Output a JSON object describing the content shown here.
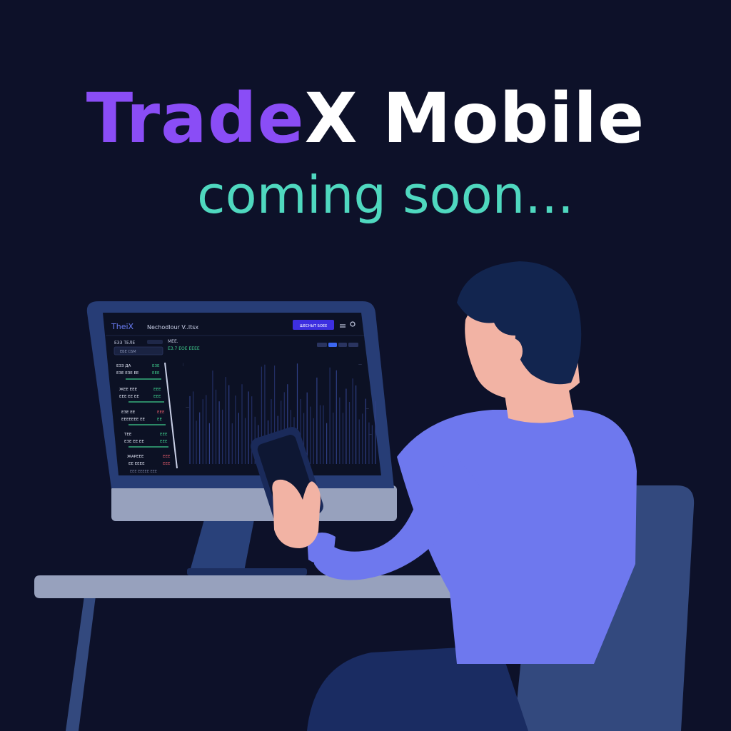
{
  "headline": {
    "brand_part_one": "Trade",
    "brand_part_two": "X Mobile"
  },
  "subline": "coming soon...",
  "screen": {
    "logo": "TheiX",
    "page_title": "Nechodlour V..ltsx",
    "cta_label": "ШЕСНЫТ БОЕЕ",
    "sidebar_title": "ЕЗЗ ТЕЛЕ",
    "sidebar_search": "ЕБЕ СБМ",
    "chart_heading": "МЕЕ.",
    "chart_subheading": "ЕЗ.7 ЕОЕ ЕЕЕЕ",
    "watchlist": [
      {
        "name": "ЕЗЗ ДА",
        "sub": "ЕЗЕ ЕЗЕ ЕЕ",
        "value": "ЕЗЕ",
        "change": "ЕЕЕ"
      },
      {
        "name": "ЖЕЕ ЕЕЕ",
        "sub": "ЕЕЕ ЕЕ ЕЕ",
        "value": "ЕЕЕ",
        "change": "ЕЕЕ"
      },
      {
        "name": "ЕЗЕ ЕЕ",
        "sub": "ЕЕЕЕЕЕЕ ЕЕ",
        "value": "ЕЕЕ",
        "change": "ЕЕ"
      },
      {
        "name": "ТЕЕ",
        "sub": "ЕЗЕ ЕЕ ЕЕ",
        "value": "ЕЕЕ",
        "change": "ЕЕЕ"
      },
      {
        "name": "ЖАРЕЕЕ",
        "sub": "ЕЕ ЕЕЕЕ",
        "value": "ЕЕЕ",
        "change": "ЕЕЕ"
      }
    ],
    "footer": "ЕЕЕ ЕЕЕЕЕ ЕЕЕ"
  },
  "colors": {
    "background": "#0d1129",
    "brand_purple": "#8a4df6",
    "accent_teal": "#4fd8bf",
    "cta_blue": "#3d2fe0",
    "shirt": "#6e78ee",
    "hair": "#12254f",
    "chair": "#33497e"
  }
}
